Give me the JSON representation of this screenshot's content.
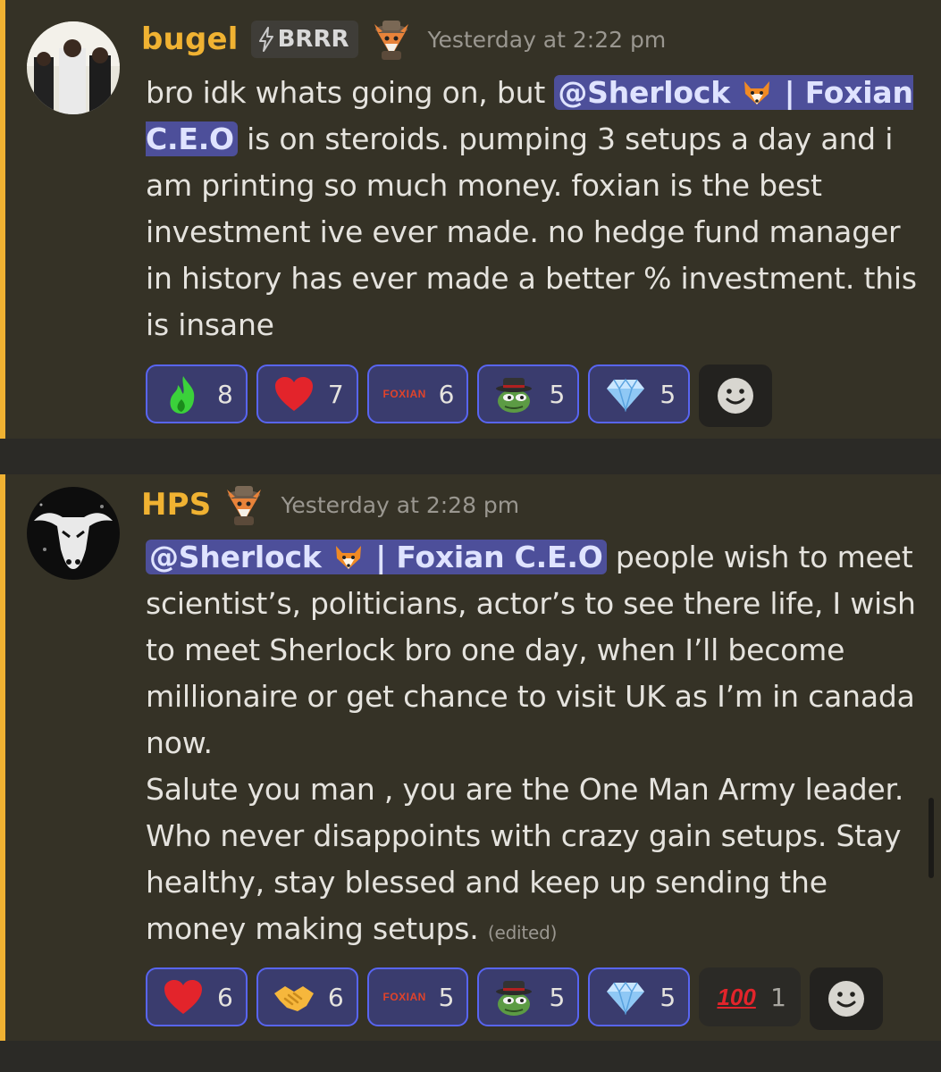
{
  "messages": [
    {
      "username": "bugel",
      "tag": "BRRR",
      "timestamp": "Yesterday at 2:22 pm",
      "content": {
        "before": "bro idk whats going on, but ",
        "mention_prefix": "@Sherlock ",
        "mention_suffix_line1": " | Foxian",
        "mention_suffix_line2": "C.E.O",
        "after": " is on steroids. pumping 3 setups a day and i am printing so much money. foxian is the best investment ive ever made. no hedge fund manager in history has ever made a better % investment. this is insane"
      },
      "reactions": [
        {
          "icon": "green-fire-icon",
          "count": "8"
        },
        {
          "icon": "red-heart-icon",
          "count": "7"
        },
        {
          "icon": "foxian-logo-icon",
          "label": "FOXIAN",
          "count": "6"
        },
        {
          "icon": "pepe-hat-icon",
          "count": "5"
        },
        {
          "icon": "diamond-icon",
          "count": "5"
        }
      ]
    },
    {
      "username": "HPS",
      "timestamp": "Yesterday at 2:28 pm",
      "content": {
        "mention_prefix": "@Sherlock ",
        "mention_suffix": " | Foxian C.E.O",
        "after": " people wish to meet scientist’s, politicians, actor’s to see there life, I wish to meet Sherlock bro one day, when I’ll become millionaire or get chance to visit UK as I’m in canada now.",
        "line2": "Salute you man , you are the One Man Army leader. Who never disappoints with crazy gain setups. Stay healthy, stay blessed and keep up sending the money making setups.",
        "edited": "(edited)"
      },
      "reactions": [
        {
          "icon": "red-heart-icon",
          "count": "6"
        },
        {
          "icon": "handshake-icon",
          "count": "6"
        },
        {
          "icon": "foxian-logo-icon",
          "label": "FOXIAN",
          "count": "5"
        },
        {
          "icon": "pepe-hat-icon",
          "count": "5"
        },
        {
          "icon": "diamond-icon",
          "count": "5"
        },
        {
          "icon": "hundred-points-icon",
          "label": "100",
          "count": "1"
        }
      ]
    }
  ],
  "colors": {
    "accent_bar": "#f0b232",
    "username": "#f0b232",
    "mention_bg": "#4d4f9a",
    "reaction_active_border": "#5865f2"
  }
}
